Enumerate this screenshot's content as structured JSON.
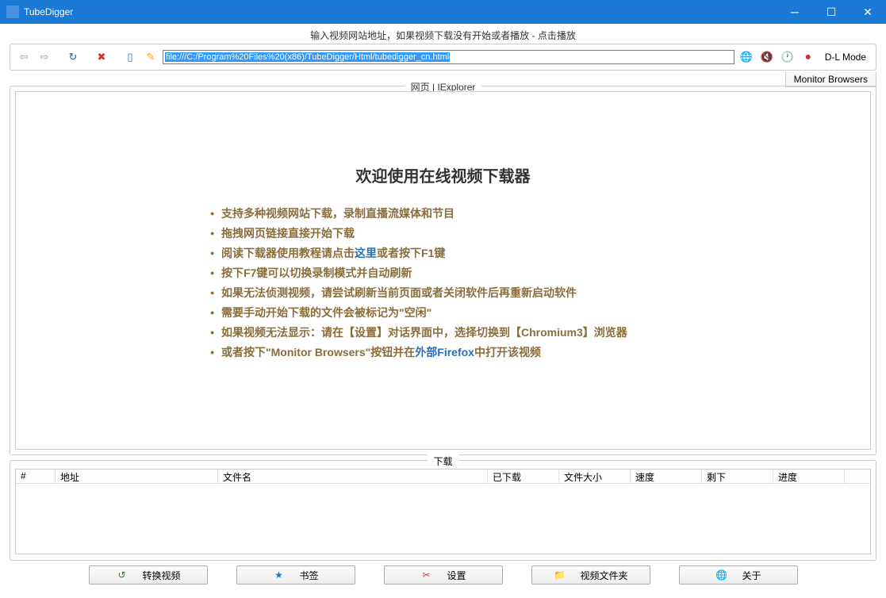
{
  "window": {
    "title": "TubeDigger"
  },
  "instruction": "输入视频网站地址，如果视频下载没有开始或者播放 - 点击播放",
  "url": "file:///C:/Program%20Files%20(x86)/TubeDigger/Html/tubedigger_cn.html",
  "dlmode_label": "D-L Mode",
  "monitor_label": "Monitor Browsers",
  "web_tab_label": "网页 | IExplorer",
  "welcome": {
    "heading": "欢迎使用在线视频下载器",
    "items": [
      {
        "text": "支持多种视频网站下载，录制直播流媒体和节目"
      },
      {
        "text": "拖拽网页链接直接开始下载"
      },
      {
        "prefix": "阅读下载器使用教程请点击",
        "link": "这里",
        "suffix": "或者按下F1键"
      },
      {
        "text": "按下F7键可以切换录制模式并自动刷新"
      },
      {
        "text": "如果无法侦测视频，请尝试刷新当前页面或者关闭软件后再重新启动软件"
      },
      {
        "text": "需要手动开始下载的文件会被标记为\"空闲\""
      },
      {
        "text": "如果视频无法显示：请在【设置】对话界面中，选择切换到【Chromium3】浏览器"
      },
      {
        "prefix": "或者按下\"Monitor Browsers\"按钮并在",
        "link": "外部Firefox",
        "suffix": "中打开该视频"
      }
    ]
  },
  "download_section": {
    "legend": "下载",
    "columns": [
      "#",
      "地址",
      "文件名",
      "已下载",
      "文件大小",
      "速度",
      "剩下",
      "进度"
    ]
  },
  "bottom_buttons": {
    "convert": "转换视频",
    "bookmark": "书签",
    "settings": "设置",
    "folder": "视频文件夹",
    "about": "关于"
  }
}
